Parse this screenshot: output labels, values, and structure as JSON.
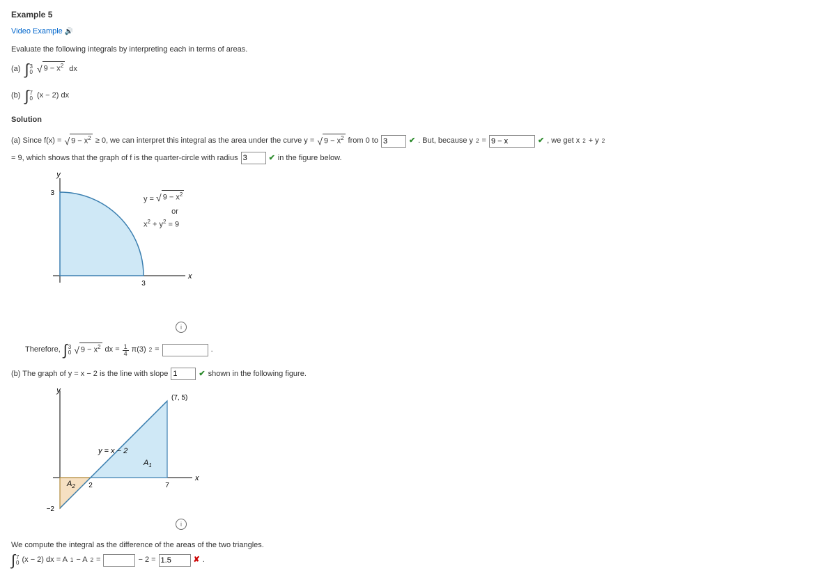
{
  "title": "Example 5",
  "video_link": "Video Example",
  "instruction": "Evaluate the following integrals by interpreting each in terms of areas.",
  "partA": {
    "label": "(a)",
    "upper": "3",
    "lower": "0",
    "sqarg": "9 − x",
    "dx": "dx"
  },
  "partB": {
    "label": "(b)",
    "upper": "7",
    "lower": "0",
    "integrand": "(x − 2) dx"
  },
  "solution_head": "Solution",
  "solA": {
    "prefix": "(a)   Since f(x) = ",
    "sq1": "9 − x",
    "mid1": " ≥ 0, we can interpret this integral as the area under the curve y = ",
    "sq2": "9 − x",
    "mid2": " from 0 to ",
    "ans1": "3",
    "mid3": " . But, because y",
    "mid3b": " = ",
    "ans2": "9 − x",
    "mid4": " , we get x",
    "mid4b": " + y",
    "mid4c": " = 9, which shows that the graph of f is the quarter-circle with radius ",
    "ans3": "3",
    "mid5": " in the figure below."
  },
  "therefore": {
    "label": "Therefore,",
    "upper": "3",
    "lower": "0",
    "sq": "9 − x",
    "eq": " dx = ",
    "frac_n": "1",
    "frac_d": "4",
    "pi": "π(3)",
    "eq2": " = "
  },
  "solB": {
    "prefix": "(b)   The graph of y = x − 2 is the line with slope ",
    "ans": "1",
    "suffix": " shown in the following figure."
  },
  "compute": {
    "text": "We compute the integral as the difference of the areas of the two triangles.",
    "upper": "7",
    "lower": "0",
    "integrand": "(x − 2) dx = A",
    "sub1": "1",
    "minus": " − A",
    "sub2": "2",
    "eq": " = ",
    "ans1": "",
    "mid": " − 2 = ",
    "ans2": "1.5",
    "dot": " ."
  },
  "chart_data": [
    {
      "type": "area",
      "title": "",
      "xlabel": "x",
      "ylabel": "y",
      "xlim": [
        0,
        3.5
      ],
      "ylim": [
        0,
        3.5
      ],
      "annotations": [
        "y = √(9 − x²)",
        "or",
        "x² + y² = 9",
        "3",
        "3"
      ],
      "series": [
        {
          "name": "quarter-circle",
          "x": [
            0,
            0.5,
            1.0,
            1.5,
            2.0,
            2.5,
            3.0
          ],
          "y": [
            3.0,
            2.958,
            2.828,
            2.598,
            2.236,
            1.658,
            0.0
          ]
        }
      ]
    },
    {
      "type": "area",
      "title": "",
      "xlabel": "x",
      "ylabel": "y",
      "xlim": [
        0,
        7.5
      ],
      "ylim": [
        -2.5,
        5.5
      ],
      "annotations": [
        "y = x − 2",
        "(7, 5)",
        "A₁",
        "A₂",
        "2",
        "7",
        "−2"
      ],
      "series": [
        {
          "name": "line",
          "x": [
            0,
            7
          ],
          "y": [
            -2,
            5
          ]
        }
      ]
    }
  ],
  "fig1": {
    "y": "y",
    "x": "x",
    "tick3a": "3",
    "tick3b": "3",
    "eq1": "y = ",
    "sq": "9 − x",
    "or": "or",
    "eq2a": "x",
    "eq2b": " + y",
    "eq2c": " = 9"
  },
  "fig2": {
    "y": "y",
    "x": "x",
    "pt": "(7, 5)",
    "line": "y = x − 2",
    "A1": "A",
    "A1s": "1",
    "A2": "A",
    "A2s": "2",
    "t2": "2",
    "t7": "7",
    "tm2": "−2"
  }
}
